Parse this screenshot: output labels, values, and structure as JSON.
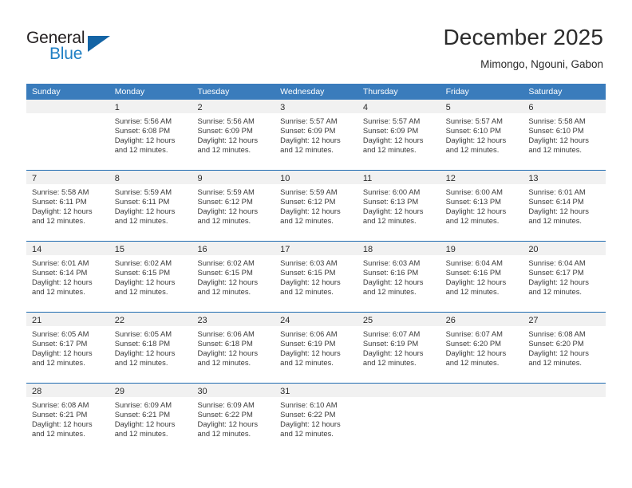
{
  "brand": {
    "word_general": "General",
    "word_blue": "Blue",
    "triangle_color": "#1464a5",
    "blue_color": "#1f7fc4"
  },
  "header": {
    "month_title": "December 2025",
    "location": "Mimongo, Ngouni, Gabon"
  },
  "theme": {
    "header_blue": "#3a7cbc",
    "rule_blue": "#1f6bb0",
    "daynum_band": "#f1f1f1",
    "text": "#3a3a3a"
  },
  "weekdays": [
    "Sunday",
    "Monday",
    "Tuesday",
    "Wednesday",
    "Thursday",
    "Friday",
    "Saturday"
  ],
  "weeks": [
    {
      "days": [
        {
          "num": "",
          "sunrise": "",
          "sunset": "",
          "daylight_1": "",
          "daylight_2": "",
          "empty": true
        },
        {
          "num": "1",
          "sunrise": "Sunrise: 5:56 AM",
          "sunset": "Sunset: 6:08 PM",
          "daylight_1": "Daylight: 12 hours",
          "daylight_2": "and 12 minutes."
        },
        {
          "num": "2",
          "sunrise": "Sunrise: 5:56 AM",
          "sunset": "Sunset: 6:09 PM",
          "daylight_1": "Daylight: 12 hours",
          "daylight_2": "and 12 minutes."
        },
        {
          "num": "3",
          "sunrise": "Sunrise: 5:57 AM",
          "sunset": "Sunset: 6:09 PM",
          "daylight_1": "Daylight: 12 hours",
          "daylight_2": "and 12 minutes."
        },
        {
          "num": "4",
          "sunrise": "Sunrise: 5:57 AM",
          "sunset": "Sunset: 6:09 PM",
          "daylight_1": "Daylight: 12 hours",
          "daylight_2": "and 12 minutes."
        },
        {
          "num": "5",
          "sunrise": "Sunrise: 5:57 AM",
          "sunset": "Sunset: 6:10 PM",
          "daylight_1": "Daylight: 12 hours",
          "daylight_2": "and 12 minutes."
        },
        {
          "num": "6",
          "sunrise": "Sunrise: 5:58 AM",
          "sunset": "Sunset: 6:10 PM",
          "daylight_1": "Daylight: 12 hours",
          "daylight_2": "and 12 minutes."
        }
      ]
    },
    {
      "days": [
        {
          "num": "7",
          "sunrise": "Sunrise: 5:58 AM",
          "sunset": "Sunset: 6:11 PM",
          "daylight_1": "Daylight: 12 hours",
          "daylight_2": "and 12 minutes."
        },
        {
          "num": "8",
          "sunrise": "Sunrise: 5:59 AM",
          "sunset": "Sunset: 6:11 PM",
          "daylight_1": "Daylight: 12 hours",
          "daylight_2": "and 12 minutes."
        },
        {
          "num": "9",
          "sunrise": "Sunrise: 5:59 AM",
          "sunset": "Sunset: 6:12 PM",
          "daylight_1": "Daylight: 12 hours",
          "daylight_2": "and 12 minutes."
        },
        {
          "num": "10",
          "sunrise": "Sunrise: 5:59 AM",
          "sunset": "Sunset: 6:12 PM",
          "daylight_1": "Daylight: 12 hours",
          "daylight_2": "and 12 minutes."
        },
        {
          "num": "11",
          "sunrise": "Sunrise: 6:00 AM",
          "sunset": "Sunset: 6:13 PM",
          "daylight_1": "Daylight: 12 hours",
          "daylight_2": "and 12 minutes."
        },
        {
          "num": "12",
          "sunrise": "Sunrise: 6:00 AM",
          "sunset": "Sunset: 6:13 PM",
          "daylight_1": "Daylight: 12 hours",
          "daylight_2": "and 12 minutes."
        },
        {
          "num": "13",
          "sunrise": "Sunrise: 6:01 AM",
          "sunset": "Sunset: 6:14 PM",
          "daylight_1": "Daylight: 12 hours",
          "daylight_2": "and 12 minutes."
        }
      ]
    },
    {
      "days": [
        {
          "num": "14",
          "sunrise": "Sunrise: 6:01 AM",
          "sunset": "Sunset: 6:14 PM",
          "daylight_1": "Daylight: 12 hours",
          "daylight_2": "and 12 minutes."
        },
        {
          "num": "15",
          "sunrise": "Sunrise: 6:02 AM",
          "sunset": "Sunset: 6:15 PM",
          "daylight_1": "Daylight: 12 hours",
          "daylight_2": "and 12 minutes."
        },
        {
          "num": "16",
          "sunrise": "Sunrise: 6:02 AM",
          "sunset": "Sunset: 6:15 PM",
          "daylight_1": "Daylight: 12 hours",
          "daylight_2": "and 12 minutes."
        },
        {
          "num": "17",
          "sunrise": "Sunrise: 6:03 AM",
          "sunset": "Sunset: 6:15 PM",
          "daylight_1": "Daylight: 12 hours",
          "daylight_2": "and 12 minutes."
        },
        {
          "num": "18",
          "sunrise": "Sunrise: 6:03 AM",
          "sunset": "Sunset: 6:16 PM",
          "daylight_1": "Daylight: 12 hours",
          "daylight_2": "and 12 minutes."
        },
        {
          "num": "19",
          "sunrise": "Sunrise: 6:04 AM",
          "sunset": "Sunset: 6:16 PM",
          "daylight_1": "Daylight: 12 hours",
          "daylight_2": "and 12 minutes."
        },
        {
          "num": "20",
          "sunrise": "Sunrise: 6:04 AM",
          "sunset": "Sunset: 6:17 PM",
          "daylight_1": "Daylight: 12 hours",
          "daylight_2": "and 12 minutes."
        }
      ]
    },
    {
      "days": [
        {
          "num": "21",
          "sunrise": "Sunrise: 6:05 AM",
          "sunset": "Sunset: 6:17 PM",
          "daylight_1": "Daylight: 12 hours",
          "daylight_2": "and 12 minutes."
        },
        {
          "num": "22",
          "sunrise": "Sunrise: 6:05 AM",
          "sunset": "Sunset: 6:18 PM",
          "daylight_1": "Daylight: 12 hours",
          "daylight_2": "and 12 minutes."
        },
        {
          "num": "23",
          "sunrise": "Sunrise: 6:06 AM",
          "sunset": "Sunset: 6:18 PM",
          "daylight_1": "Daylight: 12 hours",
          "daylight_2": "and 12 minutes."
        },
        {
          "num": "24",
          "sunrise": "Sunrise: 6:06 AM",
          "sunset": "Sunset: 6:19 PM",
          "daylight_1": "Daylight: 12 hours",
          "daylight_2": "and 12 minutes."
        },
        {
          "num": "25",
          "sunrise": "Sunrise: 6:07 AM",
          "sunset": "Sunset: 6:19 PM",
          "daylight_1": "Daylight: 12 hours",
          "daylight_2": "and 12 minutes."
        },
        {
          "num": "26",
          "sunrise": "Sunrise: 6:07 AM",
          "sunset": "Sunset: 6:20 PM",
          "daylight_1": "Daylight: 12 hours",
          "daylight_2": "and 12 minutes."
        },
        {
          "num": "27",
          "sunrise": "Sunrise: 6:08 AM",
          "sunset": "Sunset: 6:20 PM",
          "daylight_1": "Daylight: 12 hours",
          "daylight_2": "and 12 minutes."
        }
      ]
    },
    {
      "days": [
        {
          "num": "28",
          "sunrise": "Sunrise: 6:08 AM",
          "sunset": "Sunset: 6:21 PM",
          "daylight_1": "Daylight: 12 hours",
          "daylight_2": "and 12 minutes."
        },
        {
          "num": "29",
          "sunrise": "Sunrise: 6:09 AM",
          "sunset": "Sunset: 6:21 PM",
          "daylight_1": "Daylight: 12 hours",
          "daylight_2": "and 12 minutes."
        },
        {
          "num": "30",
          "sunrise": "Sunrise: 6:09 AM",
          "sunset": "Sunset: 6:22 PM",
          "daylight_1": "Daylight: 12 hours",
          "daylight_2": "and 12 minutes."
        },
        {
          "num": "31",
          "sunrise": "Sunrise: 6:10 AM",
          "sunset": "Sunset: 6:22 PM",
          "daylight_1": "Daylight: 12 hours",
          "daylight_2": "and 12 minutes."
        },
        {
          "num": "",
          "sunrise": "",
          "sunset": "",
          "daylight_1": "",
          "daylight_2": "",
          "empty": true
        },
        {
          "num": "",
          "sunrise": "",
          "sunset": "",
          "daylight_1": "",
          "daylight_2": "",
          "empty": true
        },
        {
          "num": "",
          "sunrise": "",
          "sunset": "",
          "daylight_1": "",
          "daylight_2": "",
          "empty": true
        }
      ]
    }
  ]
}
